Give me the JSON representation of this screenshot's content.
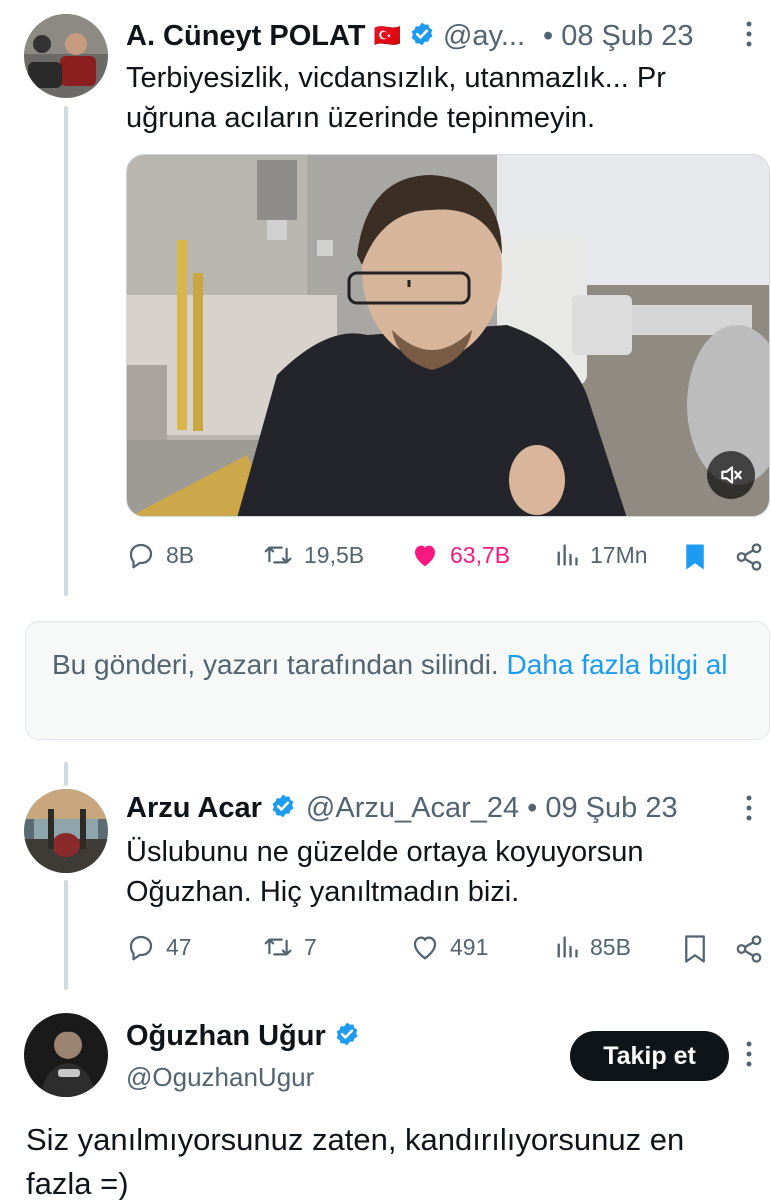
{
  "tweet1": {
    "name": "A. Cüneyt POLAT",
    "flag": "🇹🇷",
    "handle": "@ay...",
    "date": "• 08 Şub 23",
    "text_line1": "Terbiyesizlik, vicdansızlık, utanmazlık... Pr",
    "text_line2": "uğruna acıların üzerinde tepinmeyin.",
    "actions": {
      "replies": "8B",
      "retweets": "19,5B",
      "likes": "63,7B",
      "views": "17Mn"
    },
    "colors": {
      "like": "#f91880",
      "bookmark": "#1d9bf0"
    }
  },
  "deleted_notice": {
    "text": "Bu gönderi, yazarı tarafından silindi.",
    "link": "Daha fazla bilgi al",
    "link_color": "#1d9bf0"
  },
  "tweet2": {
    "name": "Arzu Acar",
    "handle": "@Arzu_Acar_24",
    "date": "• 09 Şub 23",
    "text_line1": "Üslubunu ne güzelde ortaya koyuyorsun",
    "text_line2": "Oğuzhan. Hiç yanıltmadın bizi.",
    "actions": {
      "replies": "47",
      "retweets": "7",
      "likes": "491",
      "views": "85B"
    }
  },
  "tweet3": {
    "name": "Oğuzhan Uğur",
    "handle": "@OguzhanUgur",
    "follow_label": "Takip et",
    "text_line1": "Siz yanılmıyorsunuz zaten, kandırılıyorsunuz en",
    "text_line2": "fazla =)"
  },
  "icons": {
    "verified": "verified-badge-icon",
    "more": "more-icon",
    "mute": "mute-icon"
  },
  "colors": {
    "verified": "#1d9bf0",
    "text": "#0f1419",
    "muted": "#536471"
  }
}
